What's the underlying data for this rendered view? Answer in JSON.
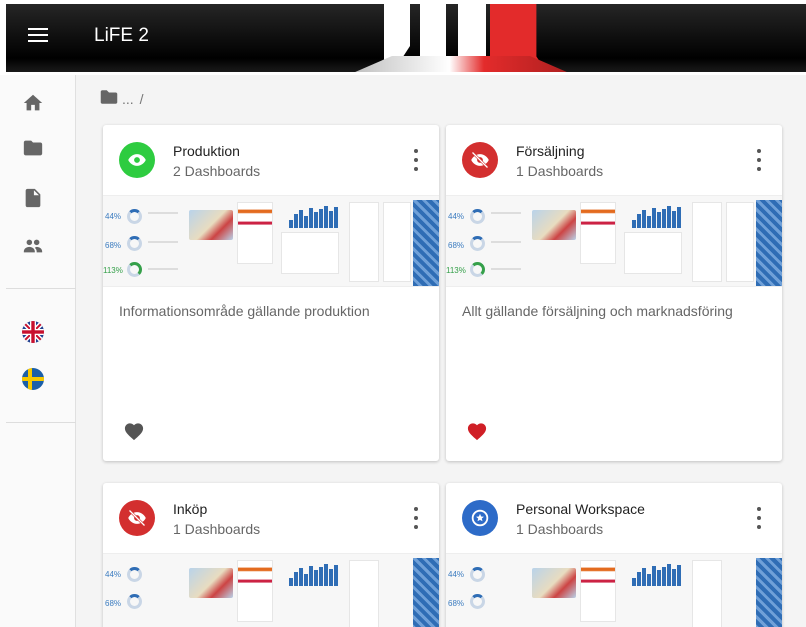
{
  "app": {
    "title": "LiFE 2"
  },
  "colors": {
    "header_bg": "#111111",
    "stripe_white": "#ffffff",
    "stripe_red": "#e32b2b",
    "green": "#2ecc40",
    "red": "#d32f2f",
    "blue": "#2d6bc8"
  },
  "breadcrumb": {
    "icon": "folder-icon",
    "text": "...",
    "separator": "/"
  },
  "sidebar": {
    "items": [
      {
        "icon": "home-icon"
      },
      {
        "icon": "folder-icon"
      },
      {
        "icon": "file-icon"
      },
      {
        "icon": "people-icon"
      }
    ],
    "languages": [
      {
        "icon": "uk-flag-icon"
      },
      {
        "icon": "sweden-flag-icon"
      }
    ]
  },
  "cards": [
    {
      "title": "Produktion",
      "subtitle": "2 Dashboards",
      "description": "Informationsområde gällande produktion",
      "icon": "eye-icon",
      "color": "#2ecc40",
      "favorite": false
    },
    {
      "title": "Försäljning",
      "subtitle": "1 Dashboards",
      "description": "Allt gällande försäljning och marknadsföring",
      "icon": "eye-off-icon",
      "color": "#d32f2f",
      "favorite": true
    },
    {
      "title": "Inköp",
      "subtitle": "1 Dashboards",
      "description": "",
      "icon": "eye-off-icon",
      "color": "#d32f2f",
      "favorite": false
    },
    {
      "title": "Personal Workspace",
      "subtitle": "1 Dashboards",
      "description": "",
      "icon": "star-icon",
      "color": "#2d6bc8",
      "favorite": false
    }
  ],
  "thumbnail": {
    "kpis": [
      "44%",
      "68%",
      "113%"
    ]
  }
}
